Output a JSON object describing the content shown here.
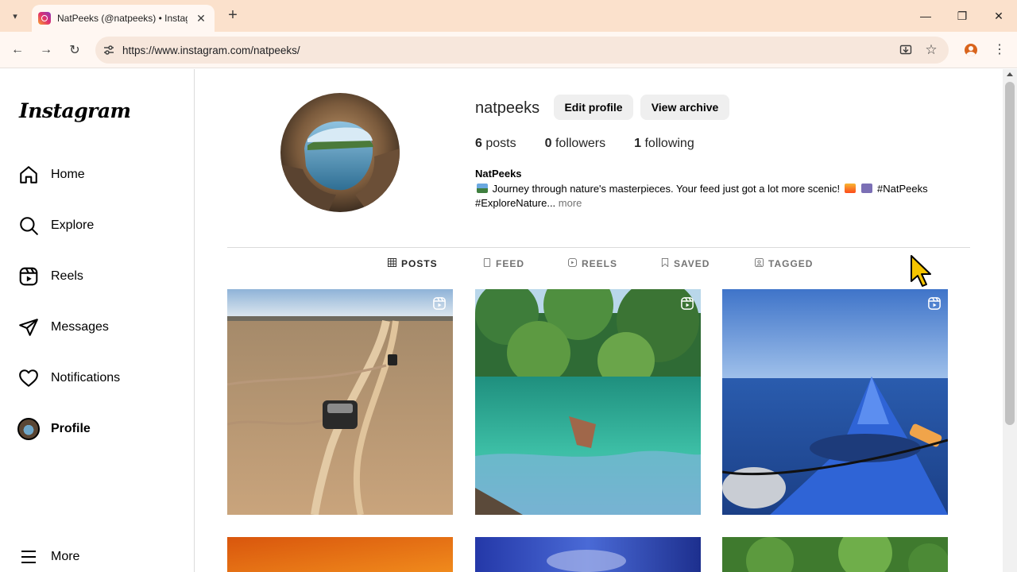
{
  "browser": {
    "tab_title": "NatPeeks (@natpeeks) • Instagram",
    "url": "https://www.instagram.com/natpeeks/",
    "tab_close": "✕",
    "new_tab": "+",
    "menu_glyph": "▾",
    "window": {
      "minimize": "—",
      "restore": "❐",
      "close": "✕"
    },
    "nav": {
      "back": "←",
      "forward": "→",
      "reload": "↻"
    },
    "site_info": "⚙",
    "install": "⇩",
    "bookmark": "☆",
    "more": "⋮",
    "colors": {
      "tabbar": "#fbe1cc",
      "toolbar": "#fff7f2",
      "omnibox": "#f7e7dc"
    }
  },
  "sidebar": {
    "logo": "Instagram",
    "items": [
      {
        "label": "Home",
        "icon": "home-icon"
      },
      {
        "label": "Explore",
        "icon": "search-icon"
      },
      {
        "label": "Reels",
        "icon": "reels-icon"
      },
      {
        "label": "Messages",
        "icon": "send-icon"
      },
      {
        "label": "Notifications",
        "icon": "heart-icon"
      },
      {
        "label": "Profile",
        "icon": "avatar",
        "active": true
      }
    ],
    "more": {
      "label": "More",
      "icon": "hamburger-icon"
    }
  },
  "profile": {
    "username": "natpeeks",
    "edit_button": "Edit profile",
    "archive_button": "View archive",
    "stats": {
      "posts_count": "6",
      "posts_label": "posts",
      "followers_count": "0",
      "followers_label": "followers",
      "following_count": "1",
      "following_label": "following"
    },
    "full_name": "NatPeeks",
    "bio_line1": "Journey through nature's masterpieces. Your feed just got a lot more scenic!",
    "bio_tag1": "#NatPeeks",
    "bio_line2": "#ExploreNature...",
    "bio_more": "more"
  },
  "tabs": [
    {
      "label": "POSTS",
      "icon": "grid-icon",
      "active": true
    },
    {
      "label": "FEED",
      "icon": "feed-icon"
    },
    {
      "label": "REELS",
      "icon": "reels-icon"
    },
    {
      "label": "SAVED",
      "icon": "bookmark-icon"
    },
    {
      "label": "TAGGED",
      "icon": "tag-icon"
    }
  ],
  "posts": [
    {
      "subject": "desert-road-vehicles",
      "reel": true
    },
    {
      "subject": "lagoon-with-boat",
      "reel": true
    },
    {
      "subject": "kayak-on-sea",
      "reel": true
    },
    {
      "subject": "orange-sunset",
      "reel": false
    },
    {
      "subject": "blue-sky",
      "reel": false
    },
    {
      "subject": "green-foliage",
      "reel": false
    }
  ]
}
